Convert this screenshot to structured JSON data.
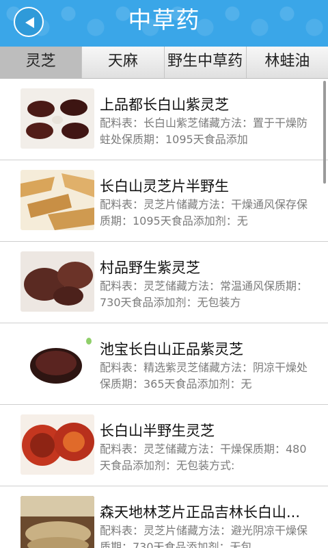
{
  "header": {
    "title": "中草药"
  },
  "tabs": [
    "灵芝",
    "天麻",
    "野生中草药",
    "林蛙油"
  ],
  "items": [
    {
      "name": "上品都长白山紫灵芝",
      "desc": "配料表：长白山紫芝储藏方法：置于干燥防蛀处保质期：1095天食品添加"
    },
    {
      "name": "长白山灵芝片半野生",
      "desc": "配料表：灵芝片储藏方法：干燥通风保存保质期：1095天食品添加剂：无"
    },
    {
      "name": "村品野生紫灵芝",
      "desc": "配料表：灵芝储藏方法：常温通风保质期：730天食品添加剂：无包装方"
    },
    {
      "name": "池宝长白山正品紫灵芝",
      "desc": "配料表：精选紫灵芝储藏方法：阴凉干燥处保质期：365天食品添加剂：无"
    },
    {
      "name": "长白山半野生灵芝",
      "desc": "配料表：灵芝储藏方法：干燥保质期：480天食品添加剂：无包装方式:"
    },
    {
      "name": "森天地林芝片正品吉林长白山...",
      "desc": "配料表：灵芝片储藏方法：避光阴凉干燥保质期：730天食品添加剂：无包"
    }
  ]
}
